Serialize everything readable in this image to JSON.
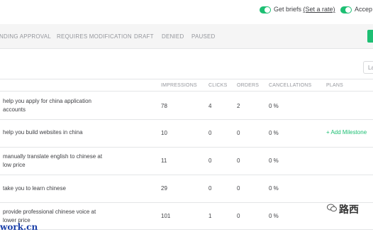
{
  "header": {
    "get_briefs_label": "Get briefs",
    "set_rate_link": "(Set a rate)",
    "accept_label": "Accep"
  },
  "tabs": [
    "NDING APPROVAL",
    "REQUIRES MODIFICATION",
    "DRAFT",
    "DENIED",
    "PAUSED"
  ],
  "filter": {
    "value": "La"
  },
  "table": {
    "columns": [
      "IMPRESSIONS",
      "CLICKS",
      "ORDERS",
      "CANCELLATIONS",
      "PLANS"
    ],
    "rows": [
      {
        "title": "help you apply for china application accounts",
        "impressions": "78",
        "clicks": "4",
        "orders": "2",
        "cancellations": "0 %",
        "plans": ""
      },
      {
        "title": "help you build websites in china",
        "impressions": "10",
        "clicks": "0",
        "orders": "0",
        "cancellations": "0 %",
        "plans": "+ Add Milestone"
      },
      {
        "title": "manually translate english to chinese at low price",
        "impressions": "11",
        "clicks": "0",
        "orders": "0",
        "cancellations": "0 %",
        "plans": ""
      },
      {
        "title": "take you to learn chinese",
        "impressions": "29",
        "clicks": "0",
        "orders": "0",
        "cancellations": "0 %",
        "plans": ""
      },
      {
        "title": "provide professional chinese voice at lower price",
        "impressions": "101",
        "clicks": "1",
        "orders": "0",
        "cancellations": "0 %",
        "plans": ""
      }
    ]
  },
  "watermark": {
    "text": "work.cn",
    "cjk": "路西"
  },
  "colors": {
    "accent": "#1dbf73",
    "muted": "#95979d",
    "text": "#404145",
    "watermark": "#1a3fa8"
  }
}
